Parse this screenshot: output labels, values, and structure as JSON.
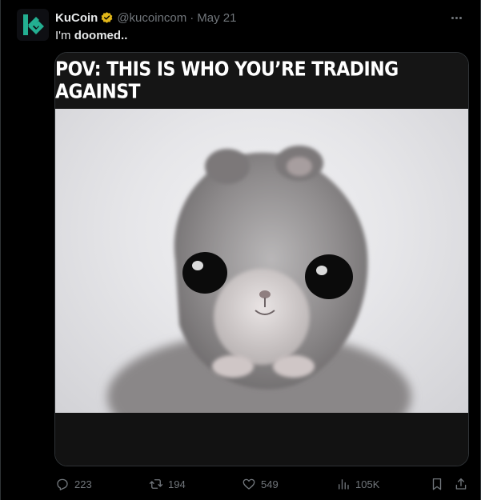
{
  "author": {
    "display_name": "KuCoin",
    "handle": "@kucoincom",
    "separator": "·",
    "date": "May 21",
    "avatar_icon": "kucoin-logo",
    "verified_icon": "verified-badge-gold",
    "brand_color": "#23af91"
  },
  "tweet": {
    "text_prefix": "I'm ",
    "text_bold": "doomed..",
    "more_icon": "more-dots-icon"
  },
  "media": {
    "caption": "POV: THIS IS WHO YOU’RE TRADING AGAINST"
  },
  "actions": {
    "replies": "223",
    "reposts": "194",
    "likes": "549",
    "views": "105K"
  },
  "colors": {
    "background": "#000000",
    "text": "#e7e9ea",
    "muted": "#71767b",
    "border": "#2f3336",
    "verified": "#e2b719"
  }
}
